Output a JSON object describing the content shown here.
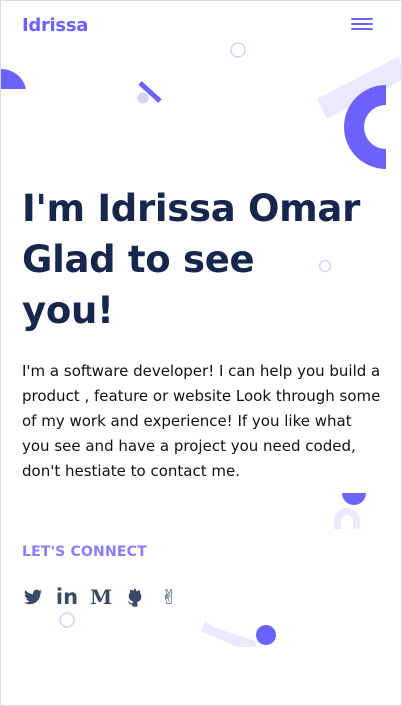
{
  "header": {
    "logo": "Idrissa",
    "menu_icon": "hamburger-menu-icon"
  },
  "hero": {
    "line1": "I'm Idrissa Omar",
    "line2": "Glad to see",
    "line3": "you!"
  },
  "intro": "I'm a software developer! I can help you build a product , feature or website Look through some of my work and experience! If you like what you see and have a project you need coded, don't hestiate to contact me.",
  "connect": {
    "label": "LET'S CONNECT"
  },
  "socials": [
    {
      "icon": "twitter-icon"
    },
    {
      "icon": "linkedin-icon",
      "glyph": "in"
    },
    {
      "icon": "medium-icon",
      "glyph": "M"
    },
    {
      "icon": "github-icon"
    },
    {
      "icon": "peace-hand-icon",
      "glyph": "✌"
    }
  ],
  "colors": {
    "accent": "#6c63ff",
    "heading": "#16264d",
    "accent_light": "#ebe9fd"
  }
}
